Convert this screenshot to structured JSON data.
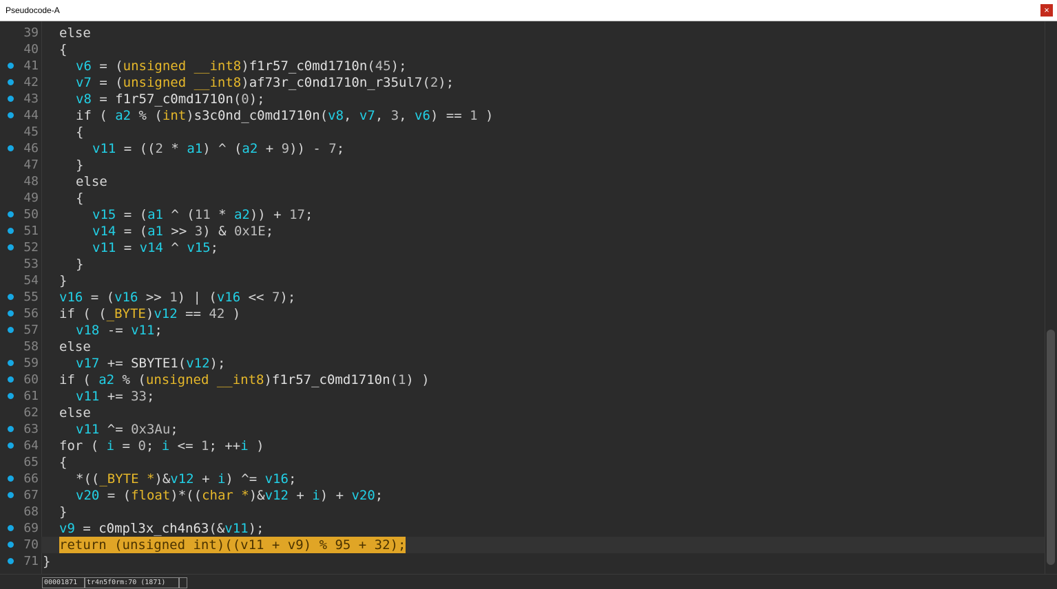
{
  "window": {
    "title": "Pseudocode-A",
    "close_label": "×"
  },
  "status": {
    "address": "00001871",
    "location": "tr4n5f0rm:70 (1871)",
    "extra": ""
  },
  "colors": {
    "variable": "#22d0e6",
    "type": "#e6b82a",
    "breakpoint_dot": "#17a8e3",
    "highlight": "#e0a526"
  },
  "lines": [
    {
      "n": "39",
      "dot": false,
      "indent": 1,
      "tokens": [
        [
          "kw",
          "else"
        ]
      ]
    },
    {
      "n": "40",
      "dot": false,
      "indent": 1,
      "tokens": [
        [
          "plain",
          "{"
        ]
      ]
    },
    {
      "n": "41",
      "dot": true,
      "indent": 2,
      "tokens": [
        [
          "var",
          "v6"
        ],
        [
          "plain",
          " = ("
        ],
        [
          "type",
          "unsigned __int8"
        ],
        [
          "plain",
          ")"
        ],
        [
          "func",
          "f1r57_c0md1710n"
        ],
        [
          "plain",
          "("
        ],
        [
          "num",
          "45"
        ],
        [
          "plain",
          ");"
        ]
      ]
    },
    {
      "n": "42",
      "dot": true,
      "indent": 2,
      "tokens": [
        [
          "var",
          "v7"
        ],
        [
          "plain",
          " = ("
        ],
        [
          "type",
          "unsigned __int8"
        ],
        [
          "plain",
          ")"
        ],
        [
          "func",
          "af73r_c0nd1710n_r35ul7"
        ],
        [
          "plain",
          "("
        ],
        [
          "num",
          "2"
        ],
        [
          "plain",
          ");"
        ]
      ]
    },
    {
      "n": "43",
      "dot": true,
      "indent": 2,
      "tokens": [
        [
          "var",
          "v8"
        ],
        [
          "plain",
          " = "
        ],
        [
          "func",
          "f1r57_c0md1710n"
        ],
        [
          "plain",
          "("
        ],
        [
          "num",
          "0"
        ],
        [
          "plain",
          ");"
        ]
      ]
    },
    {
      "n": "44",
      "dot": true,
      "indent": 2,
      "tokens": [
        [
          "kw",
          "if"
        ],
        [
          "plain",
          " ( "
        ],
        [
          "var",
          "a2"
        ],
        [
          "plain",
          " % ("
        ],
        [
          "type",
          "int"
        ],
        [
          "plain",
          ")"
        ],
        [
          "func",
          "s3c0nd_c0md1710n"
        ],
        [
          "plain",
          "("
        ],
        [
          "var",
          "v8"
        ],
        [
          "plain",
          ", "
        ],
        [
          "var",
          "v7"
        ],
        [
          "plain",
          ", "
        ],
        [
          "num",
          "3"
        ],
        [
          "plain",
          ", "
        ],
        [
          "var",
          "v6"
        ],
        [
          "plain",
          ") == "
        ],
        [
          "num",
          "1"
        ],
        [
          "plain",
          " )"
        ]
      ]
    },
    {
      "n": "45",
      "dot": false,
      "indent": 2,
      "tokens": [
        [
          "plain",
          "{"
        ]
      ]
    },
    {
      "n": "46",
      "dot": true,
      "indent": 3,
      "tokens": [
        [
          "var",
          "v11"
        ],
        [
          "plain",
          " = (("
        ],
        [
          "num",
          "2"
        ],
        [
          "plain",
          " * "
        ],
        [
          "var",
          "a1"
        ],
        [
          "plain",
          ") ^ ("
        ],
        [
          "var",
          "a2"
        ],
        [
          "plain",
          " + "
        ],
        [
          "num",
          "9"
        ],
        [
          "plain",
          ")) - "
        ],
        [
          "num",
          "7"
        ],
        [
          "plain",
          ";"
        ]
      ]
    },
    {
      "n": "47",
      "dot": false,
      "indent": 2,
      "tokens": [
        [
          "plain",
          "}"
        ]
      ]
    },
    {
      "n": "48",
      "dot": false,
      "indent": 2,
      "tokens": [
        [
          "kw",
          "else"
        ]
      ]
    },
    {
      "n": "49",
      "dot": false,
      "indent": 2,
      "tokens": [
        [
          "plain",
          "{"
        ]
      ]
    },
    {
      "n": "50",
      "dot": true,
      "indent": 3,
      "tokens": [
        [
          "var",
          "v15"
        ],
        [
          "plain",
          " = ("
        ],
        [
          "var",
          "a1"
        ],
        [
          "plain",
          " ^ ("
        ],
        [
          "num",
          "11"
        ],
        [
          "plain",
          " * "
        ],
        [
          "var",
          "a2"
        ],
        [
          "plain",
          ")) + "
        ],
        [
          "num",
          "17"
        ],
        [
          "plain",
          ";"
        ]
      ]
    },
    {
      "n": "51",
      "dot": true,
      "indent": 3,
      "tokens": [
        [
          "var",
          "v14"
        ],
        [
          "plain",
          " = ("
        ],
        [
          "var",
          "a1"
        ],
        [
          "plain",
          " >> "
        ],
        [
          "num",
          "3"
        ],
        [
          "plain",
          ") & "
        ],
        [
          "num",
          "0x1E"
        ],
        [
          "plain",
          ";"
        ]
      ]
    },
    {
      "n": "52",
      "dot": true,
      "indent": 3,
      "tokens": [
        [
          "var",
          "v11"
        ],
        [
          "plain",
          " = "
        ],
        [
          "var",
          "v14"
        ],
        [
          "plain",
          " ^ "
        ],
        [
          "var",
          "v15"
        ],
        [
          "plain",
          ";"
        ]
      ]
    },
    {
      "n": "53",
      "dot": false,
      "indent": 2,
      "tokens": [
        [
          "plain",
          "}"
        ]
      ]
    },
    {
      "n": "54",
      "dot": false,
      "indent": 1,
      "tokens": [
        [
          "plain",
          "}"
        ]
      ]
    },
    {
      "n": "55",
      "dot": true,
      "indent": 1,
      "tokens": [
        [
          "var",
          "v16"
        ],
        [
          "plain",
          " = ("
        ],
        [
          "var",
          "v16"
        ],
        [
          "plain",
          " >> "
        ],
        [
          "num",
          "1"
        ],
        [
          "plain",
          ") | ("
        ],
        [
          "var",
          "v16"
        ],
        [
          "plain",
          " << "
        ],
        [
          "num",
          "7"
        ],
        [
          "plain",
          ");"
        ]
      ]
    },
    {
      "n": "56",
      "dot": true,
      "indent": 1,
      "tokens": [
        [
          "kw",
          "if"
        ],
        [
          "plain",
          " ( ("
        ],
        [
          "type",
          "_BYTE"
        ],
        [
          "plain",
          ")"
        ],
        [
          "var",
          "v12"
        ],
        [
          "plain",
          " == "
        ],
        [
          "num",
          "42"
        ],
        [
          "plain",
          " )"
        ]
      ]
    },
    {
      "n": "57",
      "dot": true,
      "indent": 2,
      "tokens": [
        [
          "var",
          "v18"
        ],
        [
          "plain",
          " -= "
        ],
        [
          "var",
          "v11"
        ],
        [
          "plain",
          ";"
        ]
      ]
    },
    {
      "n": "58",
      "dot": false,
      "indent": 1,
      "tokens": [
        [
          "kw",
          "else"
        ]
      ]
    },
    {
      "n": "59",
      "dot": true,
      "indent": 2,
      "tokens": [
        [
          "var",
          "v17"
        ],
        [
          "plain",
          " += "
        ],
        [
          "func",
          "SBYTE1"
        ],
        [
          "plain",
          "("
        ],
        [
          "var",
          "v12"
        ],
        [
          "plain",
          ");"
        ]
      ]
    },
    {
      "n": "60",
      "dot": true,
      "indent": 1,
      "tokens": [
        [
          "kw",
          "if"
        ],
        [
          "plain",
          " ( "
        ],
        [
          "var",
          "a2"
        ],
        [
          "plain",
          " % ("
        ],
        [
          "type",
          "unsigned __int8"
        ],
        [
          "plain",
          ")"
        ],
        [
          "func",
          "f1r57_c0md1710n"
        ],
        [
          "plain",
          "("
        ],
        [
          "num",
          "1"
        ],
        [
          "plain",
          ") )"
        ]
      ]
    },
    {
      "n": "61",
      "dot": true,
      "indent": 2,
      "tokens": [
        [
          "var",
          "v11"
        ],
        [
          "plain",
          " += "
        ],
        [
          "num",
          "33"
        ],
        [
          "plain",
          ";"
        ]
      ]
    },
    {
      "n": "62",
      "dot": false,
      "indent": 1,
      "tokens": [
        [
          "kw",
          "else"
        ]
      ]
    },
    {
      "n": "63",
      "dot": true,
      "indent": 2,
      "tokens": [
        [
          "var",
          "v11"
        ],
        [
          "plain",
          " ^= "
        ],
        [
          "num",
          "0x3Au"
        ],
        [
          "plain",
          ";"
        ]
      ]
    },
    {
      "n": "64",
      "dot": true,
      "indent": 1,
      "tokens": [
        [
          "kw",
          "for"
        ],
        [
          "plain",
          " ( "
        ],
        [
          "var",
          "i"
        ],
        [
          "plain",
          " = "
        ],
        [
          "num",
          "0"
        ],
        [
          "plain",
          "; "
        ],
        [
          "var",
          "i"
        ],
        [
          "plain",
          " <= "
        ],
        [
          "num",
          "1"
        ],
        [
          "plain",
          "; ++"
        ],
        [
          "var",
          "i"
        ],
        [
          "plain",
          " )"
        ]
      ]
    },
    {
      "n": "65",
      "dot": false,
      "indent": 1,
      "tokens": [
        [
          "plain",
          "{"
        ]
      ]
    },
    {
      "n": "66",
      "dot": true,
      "indent": 2,
      "tokens": [
        [
          "plain",
          "*(("
        ],
        [
          "type",
          "_BYTE *"
        ],
        [
          "plain",
          ")&"
        ],
        [
          "var",
          "v12"
        ],
        [
          "plain",
          " + "
        ],
        [
          "var",
          "i"
        ],
        [
          "plain",
          ") ^= "
        ],
        [
          "var",
          "v16"
        ],
        [
          "plain",
          ";"
        ]
      ]
    },
    {
      "n": "67",
      "dot": true,
      "indent": 2,
      "tokens": [
        [
          "var",
          "v20"
        ],
        [
          "plain",
          " = ("
        ],
        [
          "type",
          "float"
        ],
        [
          "plain",
          ")*(("
        ],
        [
          "type",
          "char *"
        ],
        [
          "plain",
          ")&"
        ],
        [
          "var",
          "v12"
        ],
        [
          "plain",
          " + "
        ],
        [
          "var",
          "i"
        ],
        [
          "plain",
          ") + "
        ],
        [
          "var",
          "v20"
        ],
        [
          "plain",
          ";"
        ]
      ]
    },
    {
      "n": "68",
      "dot": false,
      "indent": 1,
      "tokens": [
        [
          "plain",
          "}"
        ]
      ]
    },
    {
      "n": "69",
      "dot": true,
      "indent": 1,
      "tokens": [
        [
          "var",
          "v9"
        ],
        [
          "plain",
          " = "
        ],
        [
          "func",
          "c0mpl3x_ch4n63"
        ],
        [
          "plain",
          "(&"
        ],
        [
          "var",
          "v11"
        ],
        [
          "plain",
          ");"
        ]
      ]
    },
    {
      "n": "70",
      "dot": true,
      "indent": 1,
      "current": true,
      "highlight": true,
      "tokens": [
        [
          "kw",
          "return"
        ],
        [
          "plain",
          " ("
        ],
        [
          "type",
          "unsigned int"
        ],
        [
          "plain",
          ")(("
        ],
        [
          "var",
          "v11"
        ],
        [
          "plain",
          " + "
        ],
        [
          "var",
          "v9"
        ],
        [
          "plain",
          ") % "
        ],
        [
          "num",
          "95"
        ],
        [
          "plain",
          " + "
        ],
        [
          "num",
          "32"
        ],
        [
          "plain",
          ");"
        ]
      ]
    },
    {
      "n": "71",
      "dot": true,
      "indent": 0,
      "tokens": [
        [
          "plain",
          "}"
        ]
      ]
    }
  ]
}
